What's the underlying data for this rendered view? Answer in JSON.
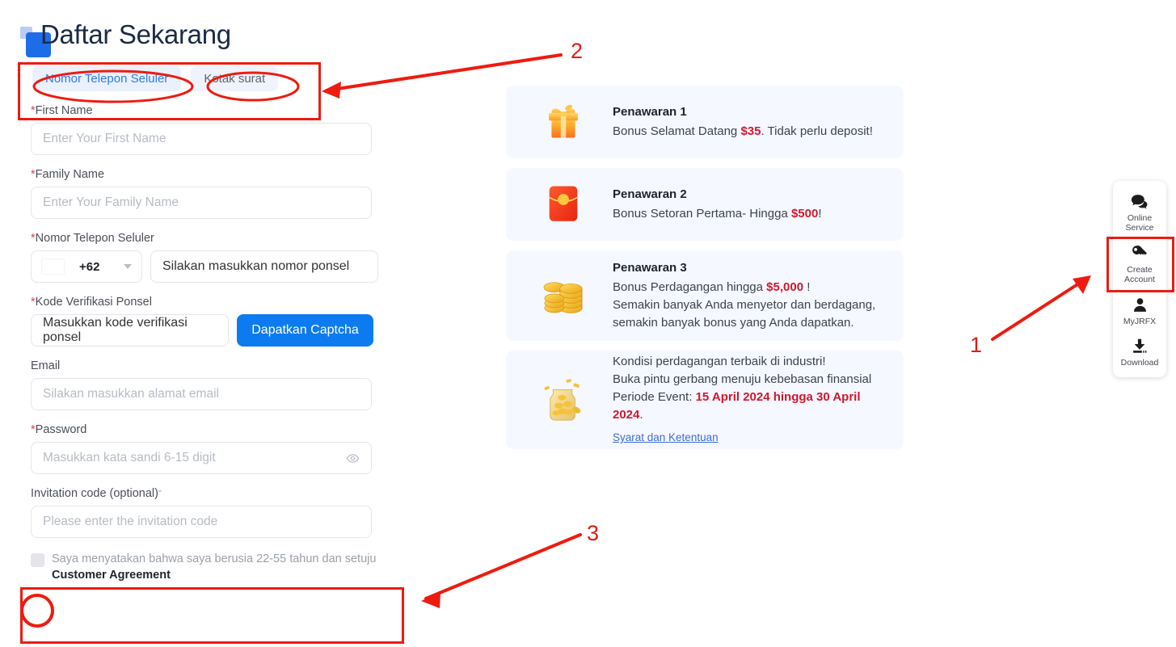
{
  "brand": {
    "logo_icon": "double-square-logo",
    "title": "Daftar Sekarang"
  },
  "tabs": [
    {
      "label": "Nomor Telepon Seluler",
      "active": true
    },
    {
      "label": "Kotak surat",
      "active": false
    }
  ],
  "form": {
    "first_name": {
      "label": "*First Name",
      "required": true,
      "placeholder": "Enter Your First Name",
      "value": ""
    },
    "family_name": {
      "label": "*Family Name",
      "required": true,
      "placeholder": "Enter Your Family Name",
      "value": ""
    },
    "phone": {
      "label": "*Nomor Telepon Seluler",
      "country_dial": "+62",
      "country_flag": "indonesia-flag",
      "placeholder": "Silakan masukkan nomor ponsel",
      "value": ""
    },
    "verification": {
      "label": "*Kode Verifikasi Ponsel",
      "placeholder": "Masukkan kode verifikasi ponsel",
      "value": "",
      "button_label": "Dapatkan Captcha"
    },
    "email": {
      "label": "Email",
      "placeholder": "Silakan masukkan alamat email",
      "value": ""
    },
    "password": {
      "label": "*Password",
      "placeholder": "Masukkan kata sandi 6-15 digit",
      "value": "",
      "toggle_icon": "eye-icon"
    },
    "invitation": {
      "label": "Invitation code (optional)",
      "chevron": "ˇ",
      "placeholder": "Please enter the invitation code",
      "value": ""
    },
    "agreement": {
      "checked": false,
      "text": "Saya menyatakan bahwa saya berusia 22-55 tahun dan setuju",
      "link_label": "Customer Agreement"
    }
  },
  "promos": [
    {
      "icon": "gift-box-icon",
      "title": "Penawaran 1",
      "line_pre": "Bonus Selamat Datang ",
      "highlight": "$35",
      "line_post": ". Tidak perlu deposit!"
    },
    {
      "icon": "red-envelope-icon",
      "title": "Penawaran 2",
      "line_pre": "Bonus Setoran Pertama- Hingga ",
      "highlight": "$500",
      "line_post": "!"
    },
    {
      "icon": "gold-coins-icon",
      "title": "Penawaran 3",
      "line_pre": "Bonus Perdagangan hingga ",
      "highlight": "$5,000",
      "line_post": " !",
      "line2": "Semakin banyak Anda menyetor dan berdagang,",
      "line3": "semakin banyak bonus yang Anda dapatkan."
    }
  ],
  "event_card": {
    "icon": "coin-jar-icon",
    "line1": "Kondisi perdagangan terbaik di industri!",
    "line2": "Buka pintu gerbang menuju kebebasan finansial",
    "line3_pre": "Periode Event: ",
    "line3_date": "15 April 2024 hingga 30 April 2024",
    "line3_post": ".",
    "terms_label": "Syarat dan Ketentuan"
  },
  "side_widget": [
    {
      "icon": "chat-bubbles-icon",
      "label": "Online\nService"
    },
    {
      "icon": "key-icon",
      "label": "Create\nAccount"
    },
    {
      "icon": "user-icon",
      "label": "MyJRFX"
    },
    {
      "icon": "download-icon",
      "label": "Download"
    }
  ],
  "annotations": [
    {
      "number": "1"
    },
    {
      "number": "2"
    },
    {
      "number": "3"
    }
  ],
  "colors": {
    "accent_blue": "#0d7bf0",
    "tab_active": "#2f7bea",
    "highlight_red": "#d3172c",
    "annotation_red": "#ee1b10",
    "card_bg": "#f5f8ff"
  }
}
